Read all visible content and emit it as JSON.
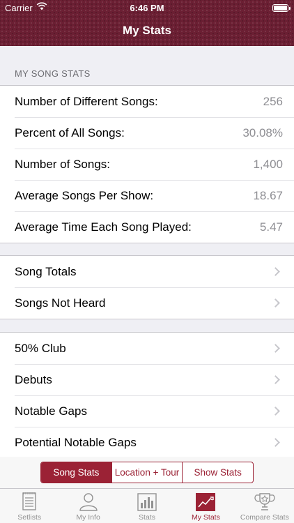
{
  "status_bar": {
    "carrier": "Carrier",
    "time": "6:46 PM"
  },
  "nav": {
    "title": "My Stats"
  },
  "song_stats": {
    "header": "MY SONG STATS",
    "rows": [
      {
        "label": "Number of Different Songs:",
        "value": "256"
      },
      {
        "label": "Percent of All Songs:",
        "value": "30.08%"
      },
      {
        "label": "Number of Songs:",
        "value": "1,400"
      },
      {
        "label": "Average Songs Per Show:",
        "value": "18.67"
      },
      {
        "label": "Average Time Each Song Played:",
        "value": "5.47"
      }
    ]
  },
  "group2": [
    {
      "label": "Song Totals"
    },
    {
      "label": "Songs Not Heard"
    }
  ],
  "group3": [
    {
      "label": "50% Club"
    },
    {
      "label": "Debuts"
    },
    {
      "label": "Notable Gaps"
    },
    {
      "label": "Potential Notable Gaps"
    }
  ],
  "segments": [
    "Song Stats",
    "Location + Tour",
    "Show Stats"
  ],
  "tabs": [
    {
      "label": "Setlists",
      "icon": "setlist-icon"
    },
    {
      "label": "My Info",
      "icon": "person-icon"
    },
    {
      "label": "Stats",
      "icon": "bar-chart-icon"
    },
    {
      "label": "My Stats",
      "icon": "trend-chart-icon"
    },
    {
      "label": "Compare Stats",
      "icon": "trophy-icon"
    }
  ],
  "colors": {
    "accent": "#9b2235",
    "header": "#6b1f33"
  }
}
